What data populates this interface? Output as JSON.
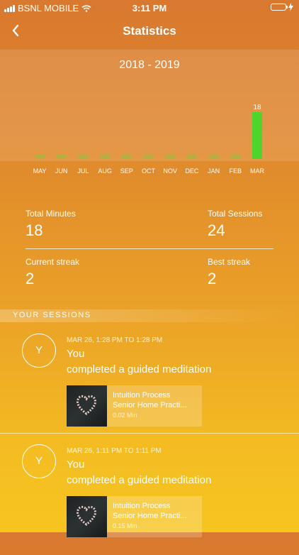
{
  "status_bar": {
    "carrier": "BSNL MOBILE",
    "time": "3:11 PM"
  },
  "nav": {
    "title": "Statistics",
    "back_icon": "chevron-left-icon"
  },
  "chart_data": {
    "type": "bar",
    "title": "2018 - 2019",
    "categories": [
      "MAY",
      "JUN",
      "JUL",
      "AUG",
      "SEP",
      "OCT",
      "NOV",
      "DEC",
      "JAN",
      "FEB",
      "MAR"
    ],
    "values": [
      0,
      0,
      0,
      0,
      0,
      0,
      0,
      0,
      0,
      0,
      18
    ],
    "data_labels": [
      "",
      "",
      "",
      "",
      "",
      "",
      "",
      "",
      "",
      "",
      "18"
    ],
    "ylim": [
      0,
      18
    ],
    "bar_color": "#4fd42c",
    "grid": false
  },
  "stats": {
    "total_minutes_label": "Total Minutes",
    "total_minutes_value": "18",
    "total_sessions_label": "Total Sessions",
    "total_sessions_value": "24",
    "current_streak_label": "Current streak",
    "current_streak_value": "2",
    "best_streak_label": "Best streak",
    "best_streak_value": "2"
  },
  "sessions_header": "YOUR SESSIONS",
  "sessions": [
    {
      "avatar": "Y",
      "time": "MAR 26, 1:28 PM TO 1:28 PM",
      "line1": "You",
      "line2": "completed a guided meditation",
      "media_title1": "Intuition Process",
      "media_title2": "Senior Home Practi...",
      "media_duration": "0.02 Min"
    },
    {
      "avatar": "Y",
      "time": "MAR 26, 1:11 PM TO 1:11 PM",
      "line1": "You",
      "line2": "completed a guided meditation",
      "media_title1": "Intuition Process",
      "media_title2": "Senior Home Practi...",
      "media_duration": "0.15 Min"
    }
  ]
}
